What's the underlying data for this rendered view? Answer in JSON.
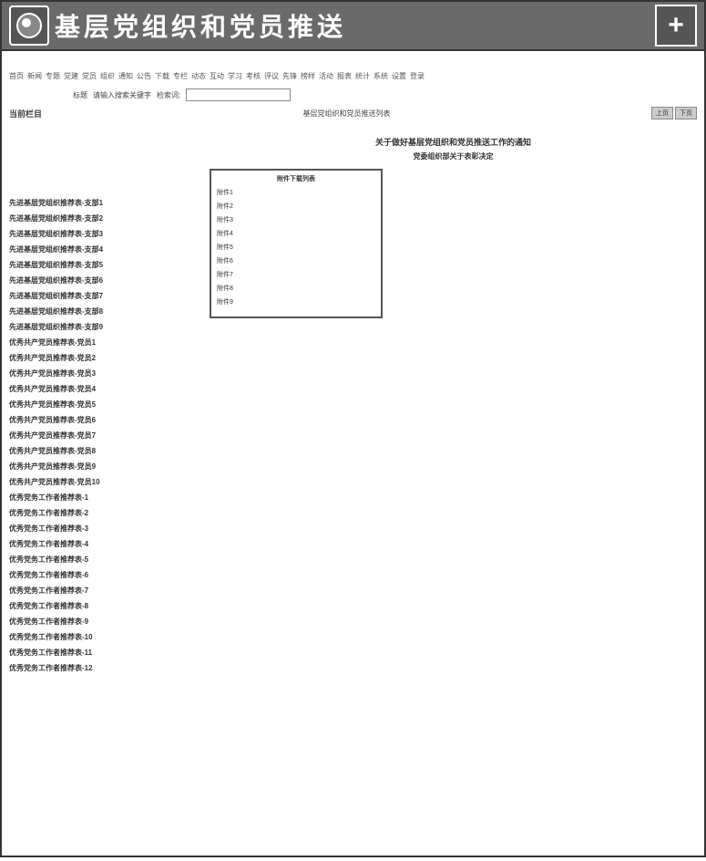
{
  "header": {
    "title": "基层党组织和党员推送",
    "plus_label": "+"
  },
  "nav_items": [
    "首页",
    "新闻",
    "专题",
    "党建",
    "党员",
    "组织",
    "通知",
    "公告",
    "下载",
    "专栏",
    "动态",
    "互动",
    "学习",
    "考核",
    "评议",
    "先锋",
    "榜样",
    "活动",
    "报表",
    "统计",
    "系统",
    "设置",
    "登录"
  ],
  "search": {
    "label": "请输入搜索关键字",
    "hint_left": "标题",
    "hint_right": "检索词:",
    "placeholder": ""
  },
  "subnav": {
    "left_label": "当前栏目",
    "center_label": "基层党组织和党员推送列表",
    "btn1": "上页",
    "btn2": "下页"
  },
  "doc": {
    "title": "关于做好基层党组织和党员推送工作的通知",
    "subtitle": "党委组织部关于表彰决定"
  },
  "box": {
    "caption": "附件下载列表",
    "rows": [
      "附件1",
      "附件2",
      "附件3",
      "附件4",
      "附件5",
      "附件6",
      "附件7",
      "附件8",
      "附件9"
    ]
  },
  "left_items": [
    "先进基层党组织推荐表-支部1",
    "先进基层党组织推荐表-支部2",
    "先进基层党组织推荐表-支部3",
    "先进基层党组织推荐表-支部4",
    "先进基层党组织推荐表-支部5",
    "先进基层党组织推荐表-支部6",
    "先进基层党组织推荐表-支部7",
    "先进基层党组织推荐表-支部8",
    "先进基层党组织推荐表-支部9",
    "优秀共产党员推荐表-党员1",
    "优秀共产党员推荐表-党员2",
    "优秀共产党员推荐表-党员3",
    "优秀共产党员推荐表-党员4",
    "优秀共产党员推荐表-党员5",
    "优秀共产党员推荐表-党员6",
    "优秀共产党员推荐表-党员7",
    "优秀共产党员推荐表-党员8",
    "优秀共产党员推荐表-党员9",
    "优秀共产党员推荐表-党员10",
    "优秀党务工作者推荐表-1",
    "优秀党务工作者推荐表-2",
    "优秀党务工作者推荐表-3",
    "优秀党务工作者推荐表-4",
    "优秀党务工作者推荐表-5",
    "优秀党务工作者推荐表-6",
    "优秀党务工作者推荐表-7",
    "优秀党务工作者推荐表-8",
    "优秀党务工作者推荐表-9",
    "优秀党务工作者推荐表-10",
    "优秀党务工作者推荐表-11",
    "优秀党务工作者推荐表-12"
  ]
}
